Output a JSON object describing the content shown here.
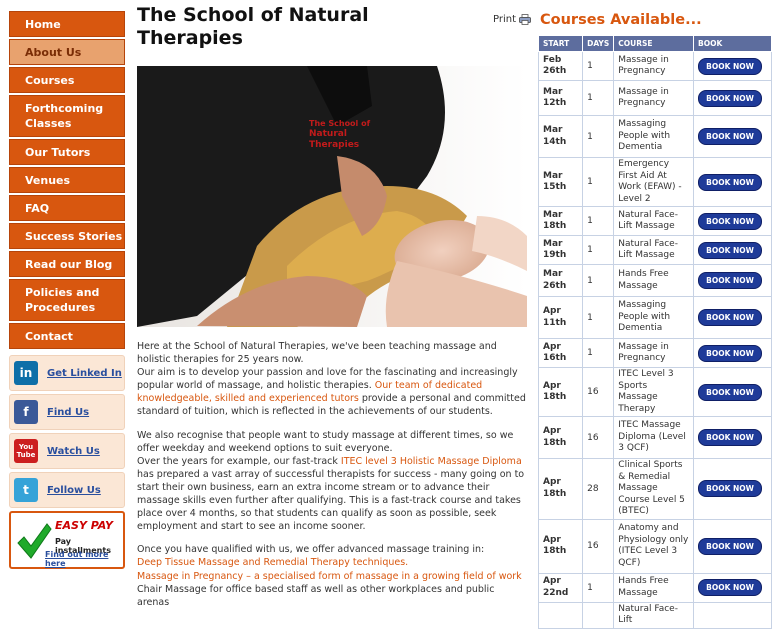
{
  "nav": [
    "Home",
    "About Us",
    "Courses",
    "Forthcoming Classes",
    "Our Tutors",
    "Venues",
    "FAQ",
    "Success Stories",
    "Read our Blog",
    "Policies and Procedures",
    "Contact"
  ],
  "nav_active": "About Us",
  "social": [
    {
      "label": "Get Linked In",
      "icon": "linkedin-icon",
      "glyph": "in",
      "color": "#0e6fa8"
    },
    {
      "label": "Find Us",
      "icon": "facebook-icon",
      "glyph": "f",
      "color": "#3b5998"
    },
    {
      "label": "Watch Us",
      "icon": "youtube-icon",
      "glyph": "You Tube",
      "color": "#cc1f1f"
    },
    {
      "label": "Follow Us",
      "icon": "twitter-icon",
      "glyph": "t",
      "color": "#36a3d8"
    }
  ],
  "easypay": {
    "title": "EASY PAY",
    "subtitle": "Pay installments",
    "link": "Find out more here"
  },
  "main": {
    "title": "The School of Natural Therapies",
    "print_label": "Print",
    "shirt_logo": "The School of Natural Therapies",
    "paragraphs": [
      {
        "parts": [
          {
            "t": "Here at the School of Natural Therapies, we've been teaching massage and holistic therapies for 25 years now."
          }
        ]
      },
      {
        "parts": [
          {
            "t": "Our aim is to develop your passion and love for the fascinating and increasingly popular world of massage, and holistic therapies. "
          },
          {
            "t": "Our team of dedicated knowledgeable, skilled and experienced tutors",
            "hl": true
          },
          {
            "t": " provide a personal and committed standard of tuition, which is reflected in the achievements of our students."
          }
        ]
      },
      {
        "gap": true
      },
      {
        "parts": [
          {
            "t": "We also recognise that people want to study massage at different times, so we offer weekday and weekend options to suit everyone."
          }
        ]
      },
      {
        "parts": [
          {
            "t": "Over the years for example, our fast-track "
          },
          {
            "t": "ITEC level 3 Holistic Massage Diploma",
            "hl": true
          },
          {
            "t": " has prepared a vast array of successful therapists for success - many going on to start their own business, earn an extra income stream or to advance their massage skills even further after qualifying. This is a fast-track course and takes place over 4 months, so that students can qualify as soon as possible, seek employment and start to see an income sooner."
          }
        ]
      },
      {
        "gap": true
      },
      {
        "parts": [
          {
            "t": "Once you have qualified with us, we offer advanced massage training in:"
          }
        ]
      },
      {
        "parts": [
          {
            "t": "Deep Tissue Massage and Remedial Therapy techniques.",
            "hl": true
          }
        ]
      },
      {
        "parts": [
          {
            "t": "Massage in Pregnancy – a specialised form of massage in a growing field of work",
            "hl": true
          }
        ]
      },
      {
        "parts": [
          {
            "t": "Chair Massage for office based staff as well as other workplaces and public arenas"
          }
        ]
      }
    ]
  },
  "courses": {
    "title": "Courses Available...",
    "headers": [
      "START",
      "DAYS",
      "COURSE",
      "BOOK"
    ],
    "book_label": "BOOK NOW",
    "rows": [
      {
        "start": "Feb 26th",
        "days": "1",
        "course": "Massage in Pregnancy"
      },
      {
        "start": "Mar 12th",
        "days": "1",
        "course": "Massage in Pregnancy"
      },
      {
        "start": "Mar 14th",
        "days": "1",
        "course": "Massaging People with Dementia"
      },
      {
        "start": "Mar 15th",
        "days": "1",
        "course": "Emergency First Aid At Work (EFAW) - Level 2"
      },
      {
        "start": "Mar 18th",
        "days": "1",
        "course": "Natural Face-Lift Massage"
      },
      {
        "start": "Mar 19th",
        "days": "1",
        "course": "Natural Face-Lift Massage"
      },
      {
        "start": "Mar 26th",
        "days": "1",
        "course": "Hands Free Massage"
      },
      {
        "start": "Apr 11th",
        "days": "1",
        "course": "Massaging People with Dementia"
      },
      {
        "start": "Apr 16th",
        "days": "1",
        "course": "Massage in Pregnancy"
      },
      {
        "start": "Apr 18th",
        "days": "16",
        "course": "ITEC Level 3 Sports Massage Therapy"
      },
      {
        "start": "Apr 18th",
        "days": "16",
        "course": "ITEC Massage Diploma (Level 3 QCF)"
      },
      {
        "start": "Apr 18th",
        "days": "28",
        "course": "Clinical Sports & Remedial Massage Course Level 5 (BTEC)"
      },
      {
        "start": "Apr 18th",
        "days": "16",
        "course": "Anatomy and Physiology only (ITEC Level 3 QCF)"
      },
      {
        "start": "Apr 22nd",
        "days": "1",
        "course": "Hands Free Massage"
      },
      {
        "start": "",
        "days": "",
        "course": "Natural Face-Lift"
      }
    ]
  },
  "colors": {
    "accent": "#d8570f",
    "nav_active_bg": "#e8a26e",
    "table_header": "#5d6d9e",
    "book_button": "#1f3b99",
    "link_blue": "#2a4f9e"
  }
}
